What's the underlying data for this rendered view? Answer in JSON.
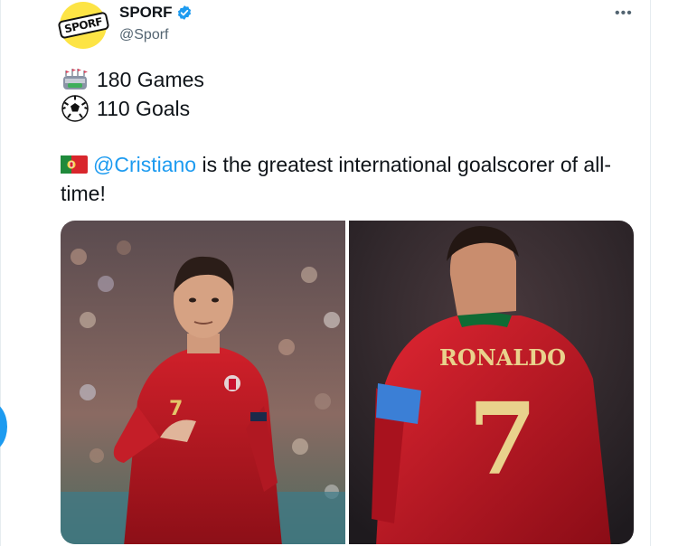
{
  "tweet": {
    "author": {
      "display_name": "SPORF",
      "handle": "@Sporf",
      "avatar_text": "SPORF",
      "verified": true
    },
    "stats": [
      {
        "icon": "stadium-icon",
        "text": "180 Games"
      },
      {
        "icon": "soccer-ball-icon",
        "text": "110 Goals"
      }
    ],
    "body": {
      "flag_icon": "portugal-flag-icon",
      "mention": "@Cristiano",
      "text_after_mention": " is the greatest international goalscorer of all-time!"
    },
    "media": {
      "photos": [
        {
          "icon": "player-celebrating-photo"
        },
        {
          "icon": "player-back-photo",
          "shirt_name": "RONALDO",
          "shirt_number": "7"
        }
      ]
    },
    "more_menu_icon": "more-icon"
  },
  "colors": {
    "accent": "#1d9bf0",
    "avatar_bg": "#fde445",
    "portugal_red": "#c8102e"
  }
}
